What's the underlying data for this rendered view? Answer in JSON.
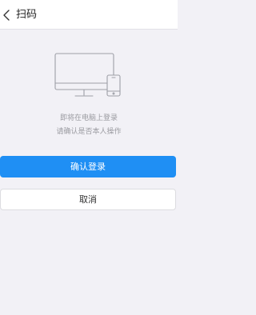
{
  "header": {
    "back_icon": "chevron-left-icon",
    "title": "扫码"
  },
  "illustration": {
    "icon": "monitor-and-phone-icon",
    "stroke_color": "#9d9ea6"
  },
  "message": {
    "line1": "即将在电脑上登录",
    "line2": "请确认是否本人操作"
  },
  "actions": {
    "confirm_label": "确认登录",
    "cancel_label": "取消"
  },
  "colors": {
    "accent": "#1f8ff4",
    "background": "#f2f1f6"
  }
}
